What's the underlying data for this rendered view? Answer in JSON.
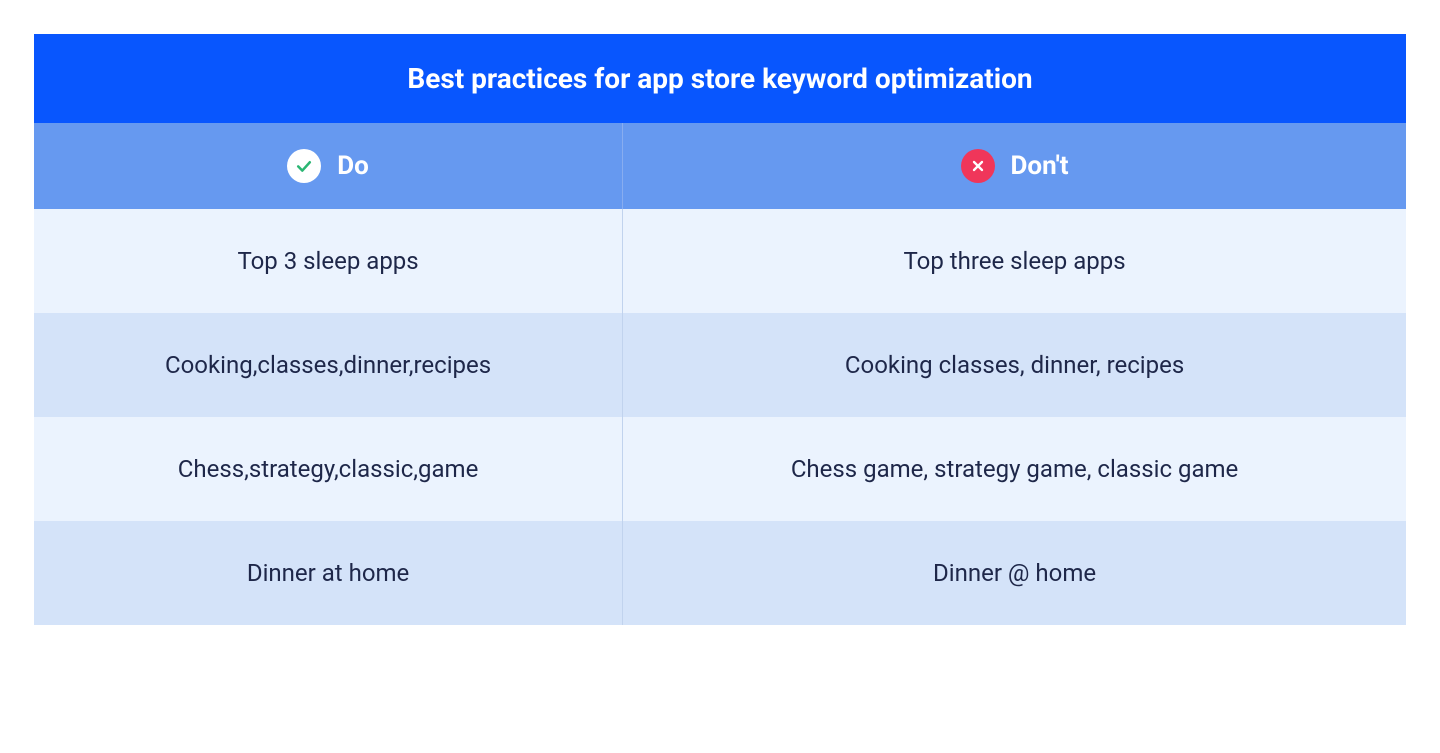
{
  "title": "Best practices for app store keyword optimization",
  "columns": {
    "do": "Do",
    "dont": "Don't"
  },
  "rows": [
    {
      "do": "Top 3 sleep apps",
      "dont": "Top three sleep apps"
    },
    {
      "do": "Cooking,classes,dinner,recipes",
      "dont": "Cooking classes, dinner, recipes"
    },
    {
      "do": "Chess,strategy,classic,game",
      "dont": "Chess game, strategy game, classic game"
    },
    {
      "do": "Dinner at home",
      "dont": "Dinner @ home"
    }
  ],
  "colors": {
    "title_bg": "#0856FE",
    "header_bg": "#6699F0",
    "row_light": "#EBF3FE",
    "row_dark": "#D4E3F9",
    "text_dark": "#1E2749",
    "check_badge_bg": "#ffffff",
    "check_stroke": "#2BB673",
    "cross_badge_bg": "#F0365A"
  }
}
